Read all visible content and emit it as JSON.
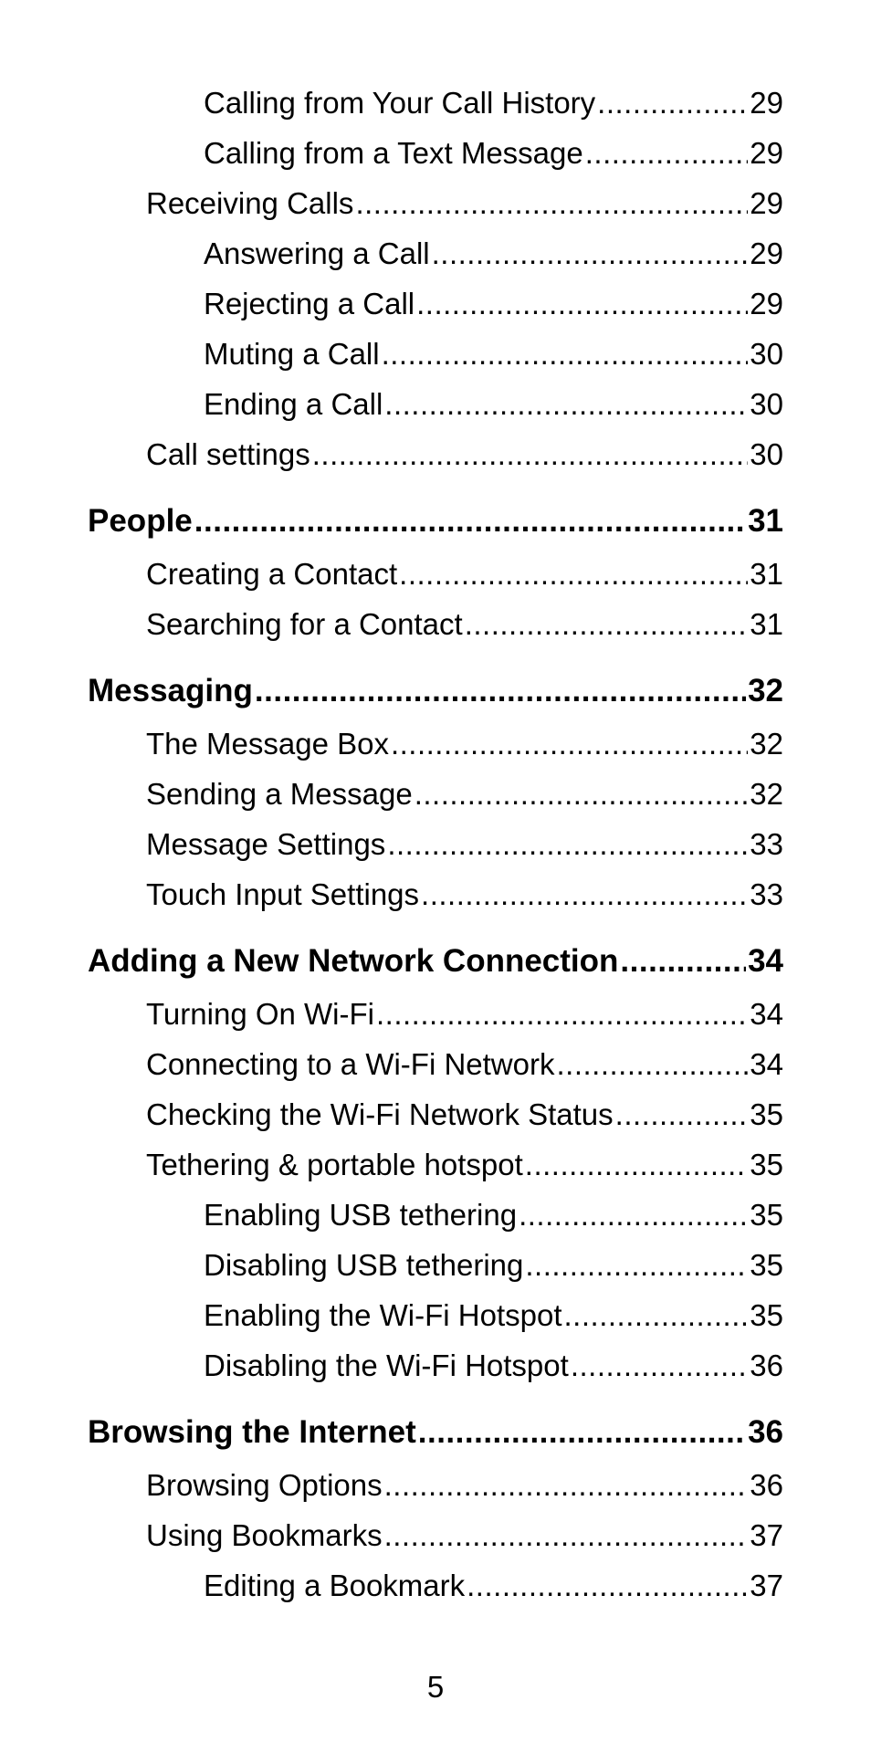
{
  "toc": {
    "entries": [
      {
        "level": 2,
        "title": "Calling from Your Call History",
        "page": "29"
      },
      {
        "level": 2,
        "title": "Calling from a Text Message",
        "page": "29"
      },
      {
        "level": 1,
        "title": "Receiving Calls",
        "page": "29"
      },
      {
        "level": 2,
        "title": "Answering a Call",
        "page": "29"
      },
      {
        "level": 2,
        "title": "Rejecting a Call",
        "page": "29"
      },
      {
        "level": 2,
        "title": "Muting a Call",
        "page": "30"
      },
      {
        "level": 2,
        "title": "Ending a Call",
        "page": "30"
      },
      {
        "level": 1,
        "title": "Call settings",
        "page": "30"
      },
      {
        "level": 0,
        "title": "People",
        "page": "31"
      },
      {
        "level": 1,
        "title": "Creating a Contact",
        "page": "31"
      },
      {
        "level": 1,
        "title": "Searching for a Contact",
        "page": "31"
      },
      {
        "level": 0,
        "title": "Messaging",
        "page": "32"
      },
      {
        "level": 1,
        "title": "The Message Box",
        "page": "32"
      },
      {
        "level": 1,
        "title": "Sending a Message",
        "page": "32"
      },
      {
        "level": 1,
        "title": "Message Settings",
        "page": "33"
      },
      {
        "level": 1,
        "title": "Touch Input Settings",
        "page": "33"
      },
      {
        "level": 0,
        "title": "Adding a New Network Connection",
        "page": "34"
      },
      {
        "level": 1,
        "title": "Turning On Wi-Fi",
        "page": "34"
      },
      {
        "level": 1,
        "title": "Connecting to a Wi-Fi Network",
        "page": "34"
      },
      {
        "level": 1,
        "title": "Checking the Wi-Fi Network Status",
        "page": "35"
      },
      {
        "level": 1,
        "title": "Tethering & portable hotspot",
        "page": "35"
      },
      {
        "level": 2,
        "title": "Enabling USB tethering",
        "page": "35"
      },
      {
        "level": 2,
        "title": "Disabling USB tethering",
        "page": "35"
      },
      {
        "level": 2,
        "title": "Enabling the Wi-Fi Hotspot",
        "page": "35"
      },
      {
        "level": 2,
        "title": "Disabling the Wi-Fi Hotspot",
        "page": "36"
      },
      {
        "level": 0,
        "title": "Browsing the Internet",
        "page": "36"
      },
      {
        "level": 1,
        "title": "Browsing Options",
        "page": "36"
      },
      {
        "level": 1,
        "title": "Using Bookmarks",
        "page": "37"
      },
      {
        "level": 2,
        "title": "Editing a Bookmark",
        "page": "37"
      }
    ]
  },
  "footer": {
    "page_number": "5"
  }
}
